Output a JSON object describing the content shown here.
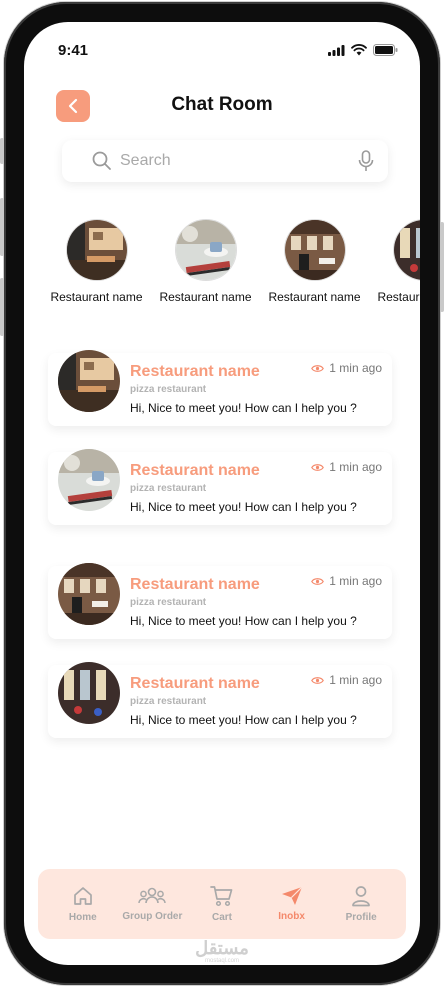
{
  "status_bar": {
    "time": "9:41"
  },
  "header": {
    "title": "Chat Room"
  },
  "search": {
    "placeholder": "Search"
  },
  "stories": [
    {
      "name": "Restaurant name"
    },
    {
      "name": "Restaurant name"
    },
    {
      "name": "Restaurant name"
    },
    {
      "name": "Restaurant name"
    }
  ],
  "chats": [
    {
      "name": "Restaurant name",
      "subtitle": "pizza restaurant",
      "message": "Hi, Nice to meet you! How can I help you ?",
      "time": "1 min ago"
    },
    {
      "name": "Restaurant name",
      "subtitle": "pizza restaurant",
      "message": "Hi, Nice to meet you! How can I help you ?",
      "time": "1 min ago"
    },
    {
      "name": "Restaurant name",
      "subtitle": "pizza restaurant",
      "message": "Hi, Nice to meet you! How can I help you ?",
      "time": "1 min ago"
    },
    {
      "name": "Restaurant name",
      "subtitle": "pizza restaurant",
      "message": "Hi, Nice to meet you! How can I help you ?",
      "time": "1 min ago"
    }
  ],
  "nav": {
    "home": "Home",
    "group_order": "Group Order",
    "cart": "Cart",
    "inbox": "Inobx",
    "profile": "Profile"
  },
  "watermark": {
    "text": "مستقل",
    "sub": "mostaql.com"
  },
  "colors": {
    "accent": "#F79C7D",
    "nav_bg": "#FEE7DE",
    "active": "#F4896B"
  }
}
